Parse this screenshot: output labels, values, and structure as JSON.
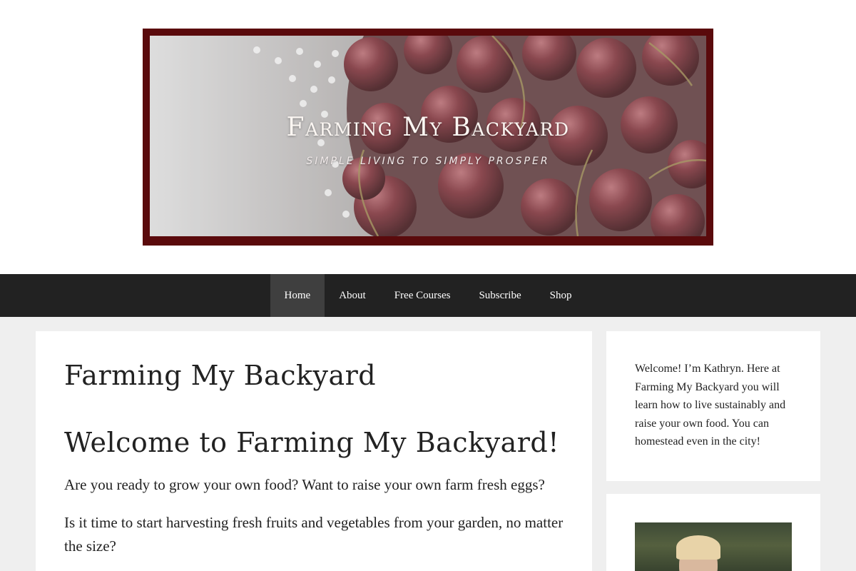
{
  "header": {
    "site_title": "Farming My Backyard",
    "tagline": "SIMPLE LIVING TO SIMPLY PROSPER"
  },
  "nav": {
    "items": [
      {
        "label": "Home",
        "active": true
      },
      {
        "label": "About",
        "active": false
      },
      {
        "label": "Free Courses",
        "active": false
      },
      {
        "label": "Subscribe",
        "active": false
      },
      {
        "label": "Shop",
        "active": false
      }
    ]
  },
  "main": {
    "page_title": "Farming My Backyard",
    "heading": "Welcome to Farming My Backyard!",
    "paragraphs": [
      "Are you ready to grow your own food? Want to raise your own farm fresh eggs?",
      "Is it time to start harvesting fresh fruits and vegetables from your garden, no matter the size?"
    ]
  },
  "sidebar": {
    "about_text": "Welcome! I’m Kathryn. Here at Farming My Backyard you will learn how to live sustainably and raise your own food. You can homestead even in the city!"
  },
  "colors": {
    "page_background": "#efefef",
    "nav_background": "#222222",
    "nav_active": "#3f3f3f",
    "banner_frame": "#5a0a0c"
  }
}
